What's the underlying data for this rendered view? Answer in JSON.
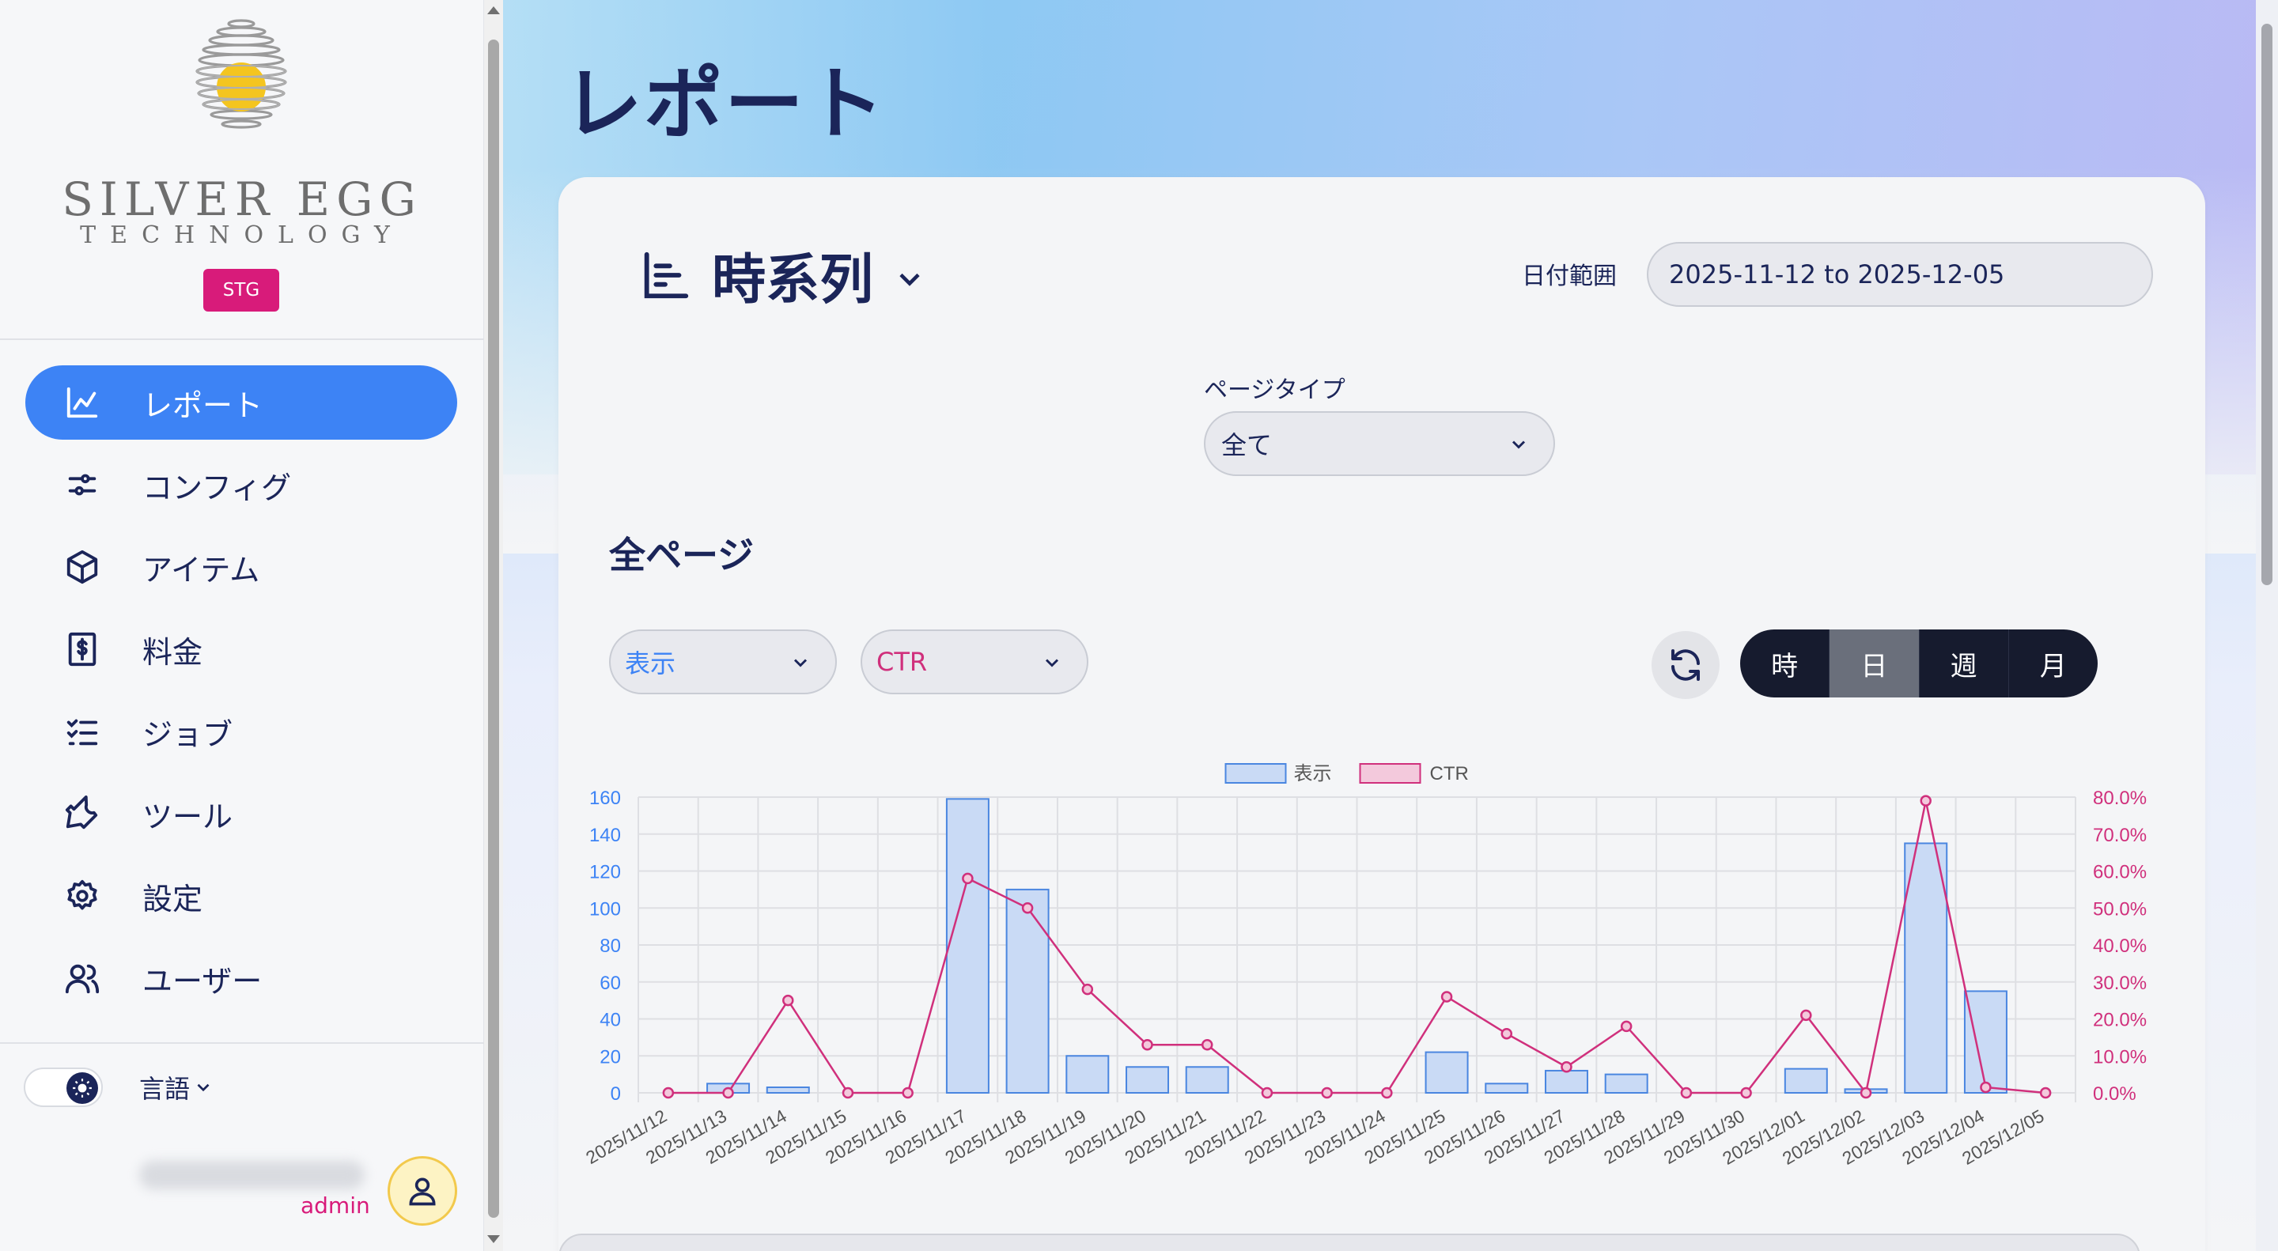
{
  "sidebar": {
    "logo_line1": "SILVER EGG",
    "logo_line2": "TECHNOLOGY",
    "env_badge": "STG",
    "nav": [
      {
        "label": "レポート",
        "icon": "chart-icon",
        "active": true
      },
      {
        "label": "コンフィグ",
        "icon": "sliders-icon",
        "active": false
      },
      {
        "label": "アイテム",
        "icon": "cube-icon",
        "active": false
      },
      {
        "label": "料金",
        "icon": "invoice-icon",
        "active": false
      },
      {
        "label": "ジョブ",
        "icon": "checklist-icon",
        "active": false
      },
      {
        "label": "ツール",
        "icon": "wrench-icon",
        "active": false
      },
      {
        "label": "設定",
        "icon": "gear-icon",
        "active": false
      },
      {
        "label": "ユーザー",
        "icon": "users-icon",
        "active": false
      }
    ],
    "language_label": "言語",
    "user_role": "admin"
  },
  "page": {
    "title": "レポート",
    "section_title": "時系列",
    "date_range_label": "日付範囲",
    "date_range_value": "2025-11-12 to 2025-12-05",
    "page_type_label": "ページタイプ",
    "page_type_value": "全て",
    "all_pages_title": "全ページ",
    "metric1": "表示",
    "metric2": "CTR",
    "granularity": [
      "時",
      "日",
      "週",
      "月"
    ],
    "granularity_selected": "日"
  },
  "colors": {
    "accent": "#3d83f5",
    "bar_fill": "#c9daf5",
    "bar_stroke": "#4a86e0",
    "ctr_line": "#d0307c",
    "brand_pink": "#d81b7a"
  },
  "chart_data": {
    "type": "bar",
    "categories": [
      "2025/11/12",
      "2025/11/13",
      "2025/11/14",
      "2025/11/15",
      "2025/11/16",
      "2025/11/17",
      "2025/11/18",
      "2025/11/19",
      "2025/11/20",
      "2025/11/21",
      "2025/11/22",
      "2025/11/23",
      "2025/11/24",
      "2025/11/25",
      "2025/11/26",
      "2025/11/27",
      "2025/11/28",
      "2025/11/29",
      "2025/11/30",
      "2025/12/01",
      "2025/12/02",
      "2025/12/03",
      "2025/12/04",
      "2025/12/05"
    ],
    "series": [
      {
        "name": "表示",
        "type": "bar",
        "axis": "left",
        "values": [
          0,
          5,
          3,
          0,
          0,
          159,
          110,
          20,
          14,
          14,
          0,
          0,
          0,
          22,
          5,
          12,
          10,
          0,
          0,
          13,
          2,
          135,
          55,
          0
        ]
      },
      {
        "name": "CTR",
        "type": "line",
        "axis": "right",
        "values": [
          0,
          0,
          25,
          0,
          0,
          58,
          50,
          28,
          13,
          13,
          0,
          0,
          0,
          26,
          16,
          7,
          18,
          0,
          0,
          21,
          0,
          79,
          1.5,
          0
        ]
      }
    ],
    "yleft_ticks": [
      "0",
      "20",
      "40",
      "60",
      "80",
      "100",
      "120",
      "140",
      "160"
    ],
    "yleft_lim": [
      0,
      160
    ],
    "yright_ticks": [
      "0.0%",
      "10.0%",
      "20.0%",
      "30.0%",
      "40.0%",
      "50.0%",
      "60.0%",
      "70.0%",
      "80.0%"
    ],
    "yright_lim": [
      0,
      80
    ],
    "grid": true,
    "legend": "top-center"
  }
}
